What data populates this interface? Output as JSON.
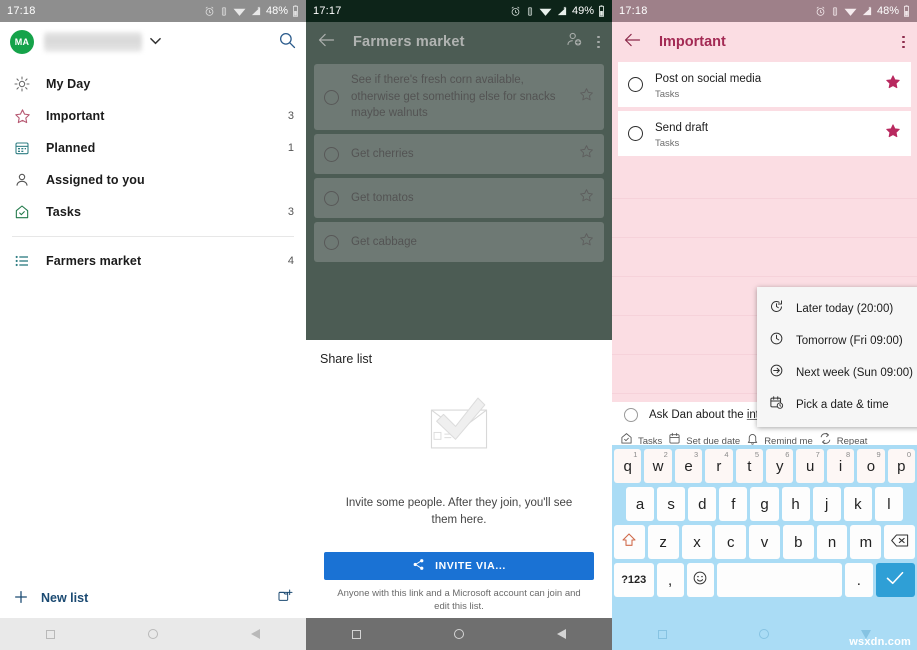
{
  "left": {
    "statusbar": {
      "time": "17:18",
      "battery": "48%",
      "icons": [
        "alarm-icon",
        "vibrate-icon",
        "wifi-icon",
        "signal-icon",
        "battery-icon"
      ]
    },
    "account": {
      "initials": "MA",
      "name_redacted": "",
      "chevron": "chevron-down-icon",
      "search": "search-icon"
    },
    "nav_items": [
      {
        "label": "My Day",
        "count": "",
        "icon": "sun-icon"
      },
      {
        "label": "Important",
        "count": "3",
        "icon": "star-icon"
      },
      {
        "label": "Planned",
        "count": "1",
        "icon": "calendar-icon"
      },
      {
        "label": "Assigned to you",
        "count": "",
        "icon": "person-icon"
      },
      {
        "label": "Tasks",
        "count": "3",
        "icon": "home-icon"
      }
    ],
    "lists": [
      {
        "label": "Farmers market",
        "count": "4",
        "icon": "list-icon"
      }
    ],
    "new_list": {
      "label": "New list",
      "plus": "plus-icon",
      "group_icon": "new-group-icon"
    }
  },
  "middle": {
    "statusbar": {
      "time": "17:17",
      "battery": "49%"
    },
    "header": {
      "title": "Farmers market",
      "back": "back-arrow-icon",
      "add_person": "add-person-icon",
      "menu": "overflow-menu-icon"
    },
    "tasks": [
      {
        "text": "See if there's fresh corn available, otherwise get something else for snacks maybe walnuts",
        "star": "star-outline-icon"
      },
      {
        "text": "Get cherries",
        "star": "star-outline-icon"
      },
      {
        "text": "Get tomatos",
        "star": "star-outline-icon"
      },
      {
        "text": "Get cabbage",
        "star": "star-outline-icon"
      }
    ],
    "share": {
      "title": "Share list",
      "illustration": "envelope-checkmark-illustration",
      "subtitle": "Invite some people. After they join, you'll see them here.",
      "button_label": "INVITE VIA...",
      "button_icon": "share-icon",
      "button_color": "#1a72d4",
      "note": "Anyone with this link and a Microsoft account can join and edit this list."
    }
  },
  "right": {
    "statusbar": {
      "time": "17:18",
      "battery": "48%"
    },
    "header": {
      "title": "Important",
      "back": "back-arrow-icon",
      "menu": "overflow-menu-icon",
      "accent": "#a32a54"
    },
    "tasks": [
      {
        "title": "Post on social media",
        "subtitle": "Tasks",
        "star": "star-filled-icon"
      },
      {
        "title": "Send draft",
        "subtitle": "Tasks",
        "star": "star-filled-icon"
      }
    ],
    "new_task": {
      "text_before": "Ask Dan about the ",
      "text_underlined": "inte"
    },
    "meta_chips": [
      {
        "label": "Tasks",
        "icon": "home-icon"
      },
      {
        "label": "Set due date",
        "icon": "calendar-icon"
      },
      {
        "label": "Remind me",
        "icon": "bell-icon"
      },
      {
        "label": "Repeat",
        "icon": "repeat-icon"
      }
    ],
    "dropdown": {
      "items": [
        {
          "label": "Later today (20:00)",
          "icon": "clock-rotate-icon"
        },
        {
          "label": "Tomorrow (Fri 09:00)",
          "icon": "clock-icon"
        },
        {
          "label": "Next week (Sun 09:00)",
          "icon": "arrow-right-circle-icon"
        },
        {
          "label": "Pick a date & time",
          "icon": "calendar-clock-icon"
        }
      ]
    },
    "keyboard": {
      "row1": [
        {
          "k": "q",
          "n": "1"
        },
        {
          "k": "w",
          "n": "2"
        },
        {
          "k": "e",
          "n": "3"
        },
        {
          "k": "r",
          "n": "4"
        },
        {
          "k": "t",
          "n": "5"
        },
        {
          "k": "y",
          "n": "6"
        },
        {
          "k": "u",
          "n": "7"
        },
        {
          "k": "i",
          "n": "8"
        },
        {
          "k": "o",
          "n": "9"
        },
        {
          "k": "p",
          "n": "0"
        }
      ],
      "row2": [
        "a",
        "s",
        "d",
        "f",
        "g",
        "h",
        "j",
        "k",
        "l"
      ],
      "row3": [
        "z",
        "x",
        "c",
        "v",
        "b",
        "n",
        "m"
      ],
      "shift_icon": "shift-icon",
      "backspace_icon": "backspace-icon",
      "symbols_label": "?123",
      "comma_label": ",",
      "emoji_icon": "emoji-icon",
      "period_label": ".",
      "enter_icon": "checkmark-icon",
      "space_label": ""
    },
    "watermark": "wsxdn.com"
  }
}
